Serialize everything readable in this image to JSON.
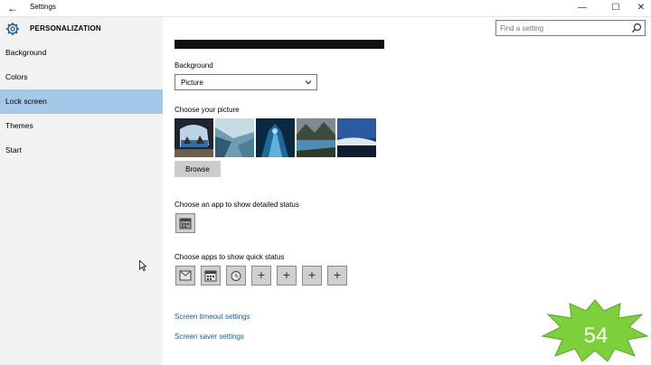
{
  "window": {
    "title": "Settings"
  },
  "header": {
    "section": "PERSONALIZATION"
  },
  "search": {
    "placeholder": "Find a setting"
  },
  "sidebar": {
    "items": [
      {
        "label": "Background"
      },
      {
        "label": "Colors"
      },
      {
        "label": "Lock screen",
        "selected": true
      },
      {
        "label": "Themes"
      },
      {
        "label": "Start"
      }
    ]
  },
  "main": {
    "background_label": "Background",
    "background_value": "Picture",
    "choose_picture_label": "Choose your picture",
    "browse_label": "Browse",
    "detailed_status_label": "Choose an app to show detailed status",
    "quick_status_label": "Choose apps to show quick status",
    "links": {
      "screen_timeout": "Screen timeout settings",
      "screen_saver": "Screen saver settings"
    }
  },
  "overlay": {
    "badge_number": "54"
  },
  "colors": {
    "accent": "#a6c8e8",
    "link": "#1a5a96",
    "badge": "#7cd13a"
  }
}
